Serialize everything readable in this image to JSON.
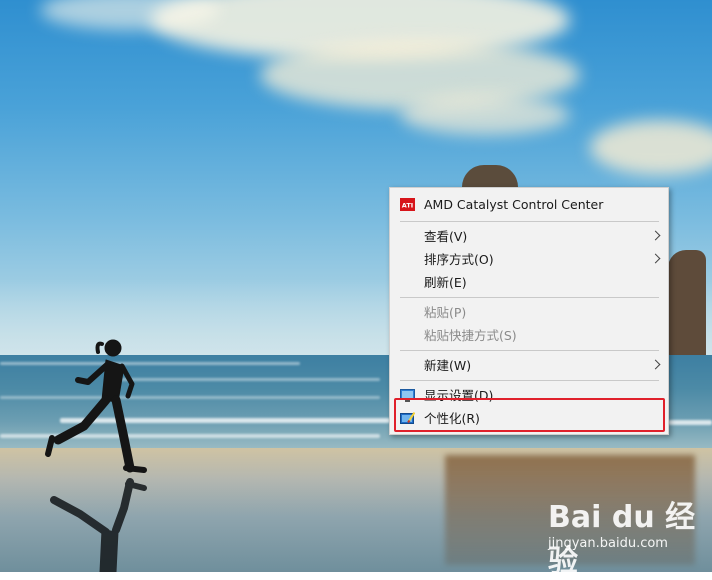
{
  "context_menu": {
    "items": [
      {
        "label": "AMD Catalyst Control Center",
        "icon": "amd-ati-icon",
        "enabled": true
      },
      {
        "label": "查看(V)",
        "submenu": true,
        "enabled": true
      },
      {
        "label": "排序方式(O)",
        "submenu": true,
        "enabled": true
      },
      {
        "label": "刷新(E)",
        "enabled": true
      },
      {
        "label": "粘贴(P)",
        "enabled": false
      },
      {
        "label": "粘贴快捷方式(S)",
        "enabled": false
      },
      {
        "label": "新建(W)",
        "submenu": true,
        "enabled": true
      },
      {
        "label": "显示设置(D)",
        "icon": "display-settings-icon",
        "enabled": true
      },
      {
        "label": "个性化(R)",
        "icon": "personalize-icon",
        "enabled": true,
        "highlighted": true
      }
    ],
    "ati_badge_text": "ATI"
  },
  "highlight": {
    "color": "#e0202b",
    "target": "个性化(R)"
  },
  "watermark": {
    "logo": "Bai du 经验",
    "url": "jingyan.baidu.com"
  },
  "colors": {
    "menu_bg": "#f2f2f2",
    "disabled_text": "#8a8a8a",
    "ati_red": "#d7141a"
  }
}
